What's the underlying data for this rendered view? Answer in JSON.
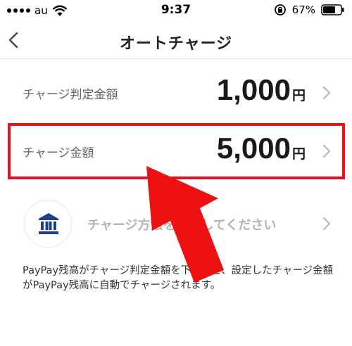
{
  "status_bar": {
    "carrier": "au",
    "time": "9:37",
    "battery_percent": "67%"
  },
  "nav": {
    "title": "オートチャージ"
  },
  "rows": [
    {
      "label": "チャージ判定金額",
      "value": "1,000",
      "unit": "円"
    },
    {
      "label": "チャージ金額",
      "value": "5,000",
      "unit": "円"
    },
    {
      "label": "チャージ方法を選択してください"
    }
  ],
  "description": "PayPay残高がチャージ判定金額を下回ると、設定したチャージ金額がPayPay残高に自動でチャージされます。",
  "colors": {
    "highlight": "#e8121b",
    "bank_icon": "#1d3f8f",
    "arrow": "#ee1111"
  }
}
